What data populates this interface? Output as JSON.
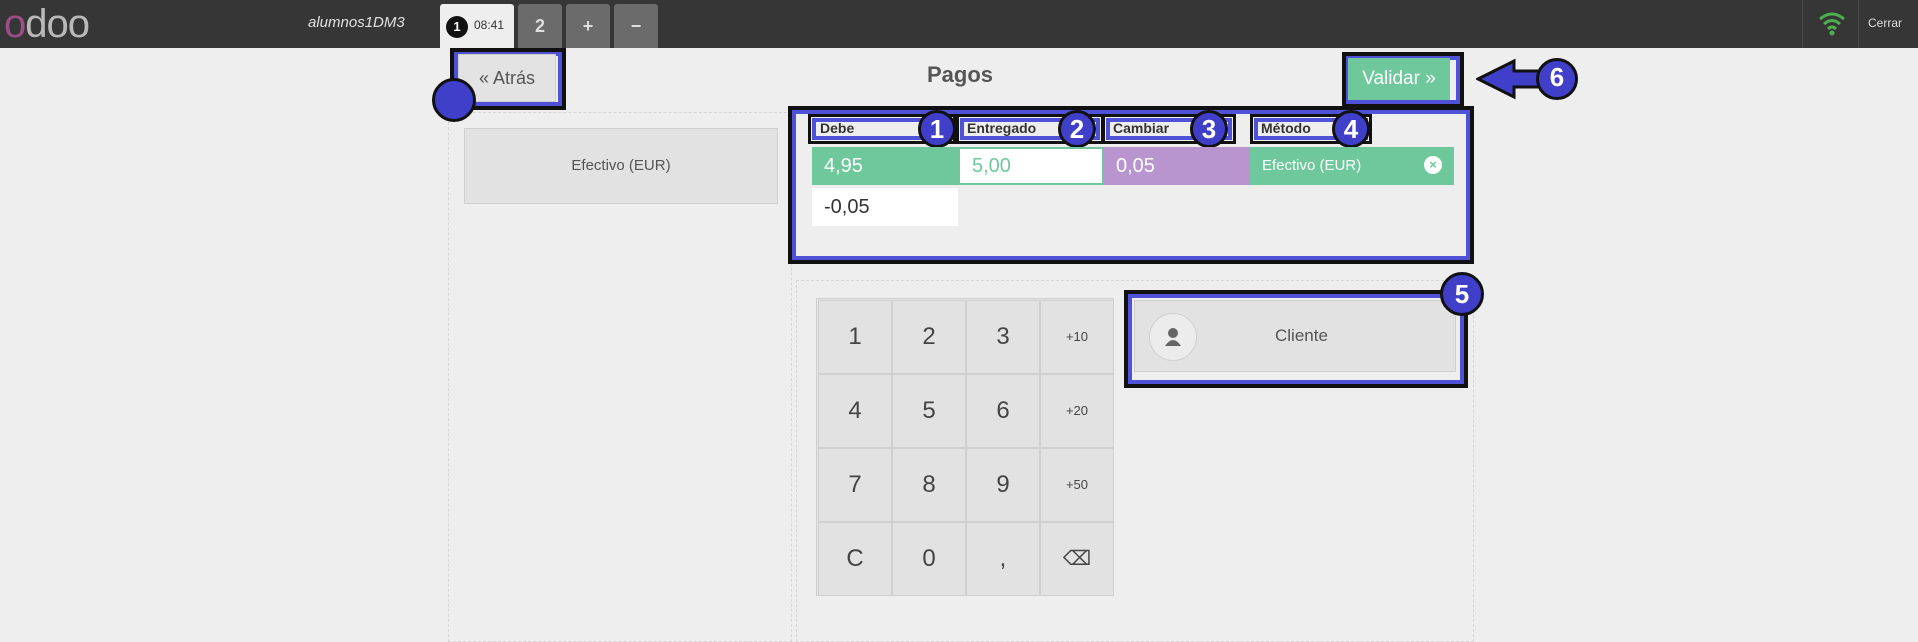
{
  "topbar": {
    "logo": "odoo",
    "shop_name": "alumnos1DM3",
    "order_number": "1",
    "order_time": "08:41",
    "tab2": "2",
    "add": "+",
    "remove": "−",
    "close": "Cerrar",
    "status_color": "#4caf50"
  },
  "screen": {
    "title": "Pagos",
    "back_label": "« Atrás",
    "validate_label": "Validar »",
    "payment_method_button": "Efectivo (EUR)"
  },
  "paymentlines": {
    "headers": [
      "Debe",
      "Entregado",
      "Cambiar",
      "Método"
    ],
    "row": {
      "due": "4,95",
      "tendered": "5,00",
      "change": "0,05",
      "method": "Efectivo (EUR)"
    },
    "remaining": "-0,05"
  },
  "numpad": {
    "keys": [
      "1",
      "2",
      "3",
      "+10",
      "4",
      "5",
      "6",
      "+20",
      "7",
      "8",
      "9",
      "+50",
      "C",
      "0",
      ",",
      "⌫"
    ]
  },
  "customer": {
    "label": "Cliente"
  },
  "annotations": {
    "m1": "1",
    "m2": "2",
    "m3": "3",
    "m4": "4",
    "m5": "5",
    "m6": "6"
  },
  "colors": {
    "due": "#6ec89b",
    "change": "#b995d0",
    "method": "#6ec89b",
    "annotation": "#3f3fc9"
  }
}
